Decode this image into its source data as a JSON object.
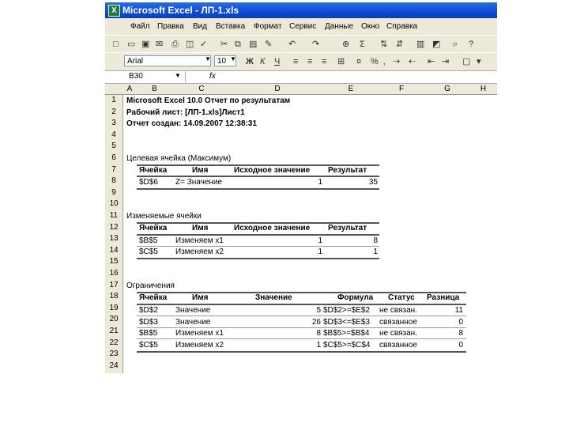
{
  "window": {
    "title": "Microsoft Excel - ЛП-1.xls"
  },
  "menu": [
    "Файл",
    "Правка",
    "Вид",
    "Вставка",
    "Формат",
    "Сервис",
    "Данные",
    "Окно",
    "Справка"
  ],
  "toolbar": {
    "font": "Arial",
    "size": "10"
  },
  "formula_bar": {
    "cell": "B30",
    "fx": "fx"
  },
  "columns": [
    "A",
    "B",
    "C",
    "D",
    "E",
    "F",
    "G",
    "H"
  ],
  "rows": [
    "1",
    "2",
    "3",
    "4",
    "5",
    "6",
    "7",
    "8",
    "9",
    "10",
    "11",
    "12",
    "13",
    "14",
    "15",
    "16",
    "17",
    "18",
    "19",
    "20",
    "21",
    "22",
    "23",
    "24"
  ],
  "report": {
    "line1": "Microsoft Excel 10.0 Отчет по результатам",
    "line2": "Рабочий лист: [ЛП-1.xls]Лист1",
    "line3": "Отчет создан: 14.09.2007 12:38:31"
  },
  "target": {
    "title": "Целевая ячейка (Максимум)",
    "headers": [
      "Ячейка",
      "Имя",
      "Исходное значение",
      "Результат"
    ],
    "row": [
      "$D$6",
      "Z= Значение",
      "1",
      "35"
    ]
  },
  "changing": {
    "title": "Изменяемые ячейки",
    "headers": [
      "Ячейка",
      "Имя",
      "Исходное значение",
      "Результат"
    ],
    "rows": [
      [
        "$B$5",
        "Изменяем x1",
        "1",
        "8"
      ],
      [
        "$C$5",
        "Изменяем x2",
        "1",
        "1"
      ]
    ]
  },
  "constraints": {
    "title": "Ограничения",
    "headers": [
      "Ячейка",
      "Имя",
      "Значение",
      "Формула",
      "Статус",
      "Разница"
    ],
    "rows": [
      [
        "$D$2",
        "Значение",
        "5",
        "$D$2>=$E$2",
        "не связан.",
        "11"
      ],
      [
        "$D$3",
        "Значение",
        "26",
        "$D$3<=$E$3",
        "связанное",
        "0"
      ],
      [
        "$B$5",
        "Изменяем x1",
        "8",
        "$B$5>=$B$4",
        "не связан.",
        "8"
      ],
      [
        "$C$5",
        "Изменяем x2",
        "1",
        "$C$5>=$C$4",
        "связанное",
        "0"
      ]
    ]
  }
}
